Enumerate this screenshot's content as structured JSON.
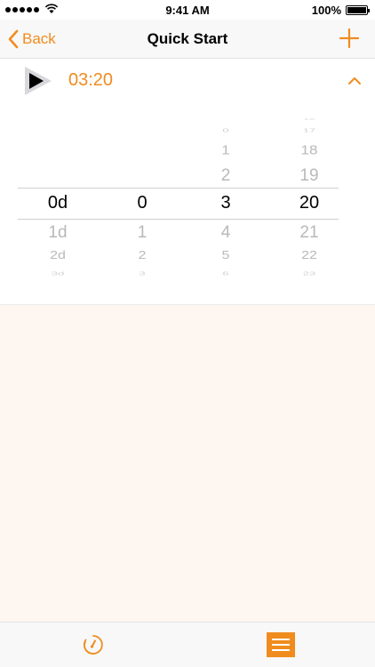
{
  "status_bar": {
    "time": "9:41 AM",
    "battery": "100%"
  },
  "nav": {
    "back_label": "Back",
    "title": "Quick Start",
    "add_icon": "plus-icon"
  },
  "timer": {
    "value": "03:20",
    "play_icon": "play-icon",
    "collapse_icon": "chevron-up-icon"
  },
  "picker": {
    "days": {
      "above": [],
      "selected": "0d",
      "below": [
        "1d",
        "2d",
        "3d"
      ]
    },
    "hours": {
      "above": [],
      "selected": "0",
      "below": [
        "1",
        "2",
        "3"
      ]
    },
    "minutes": {
      "above": [
        "0",
        "1",
        "2"
      ],
      "selected": "3",
      "below": [
        "4",
        "5",
        "6"
      ]
    },
    "seconds": {
      "above": [
        "16",
        "17",
        "18",
        "19"
      ],
      "selected": "20",
      "below": [
        "21",
        "22",
        "23"
      ]
    }
  },
  "tab_bar": {
    "timer_icon": "stopwatch-icon",
    "list_icon": "list-icon"
  },
  "colors": {
    "accent": "#f08c1e",
    "content_bg": "#fdf6f1",
    "bar_bg": "#f8f8f8"
  }
}
